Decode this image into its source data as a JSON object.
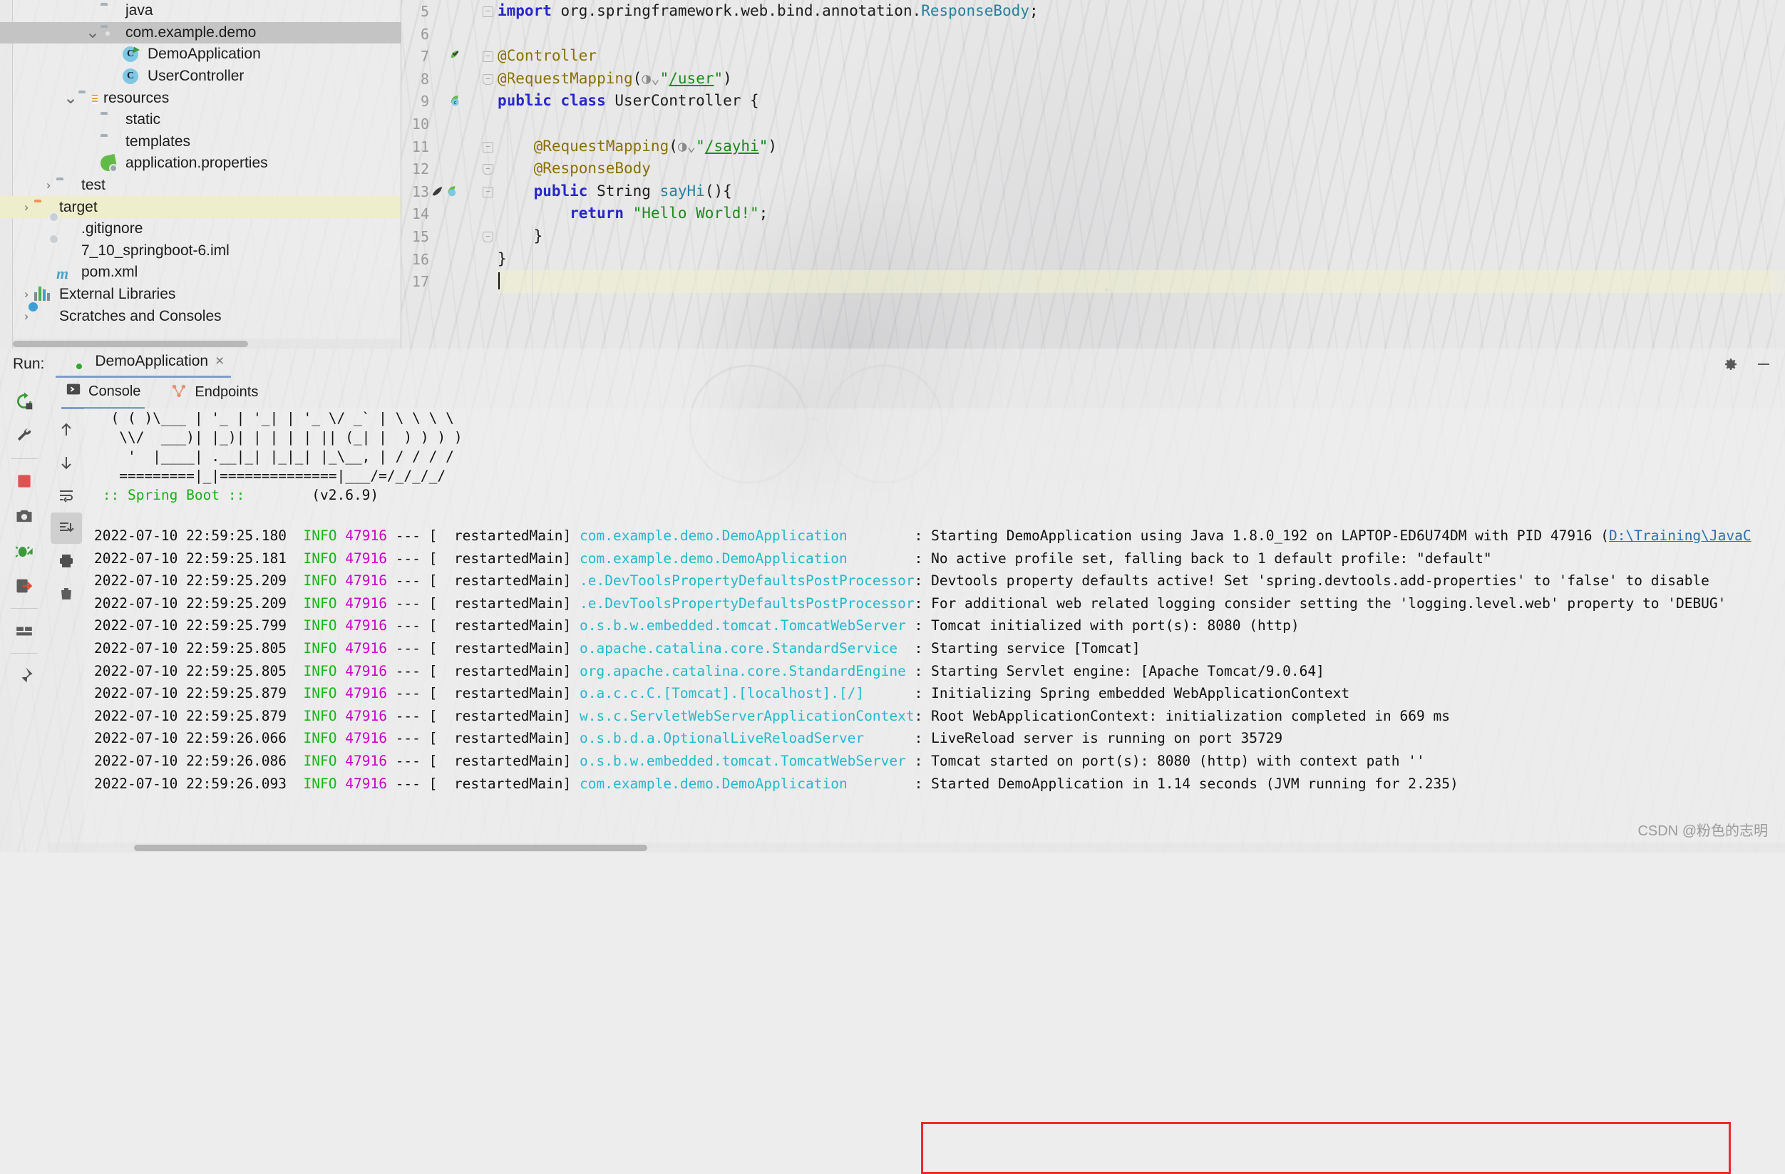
{
  "project": {
    "items": [
      {
        "indent": 3,
        "twisty": "",
        "icon": "folder-icon",
        "label": "java",
        "state": "partial"
      },
      {
        "indent": 3,
        "twisty": "v",
        "icon": "package-folder-icon",
        "label": "com.example.demo",
        "state": "selected"
      },
      {
        "indent": 4,
        "twisty": "",
        "icon": "class-run-icon",
        "label": "DemoApplication",
        "state": "normal"
      },
      {
        "indent": 4,
        "twisty": "",
        "icon": "class-icon",
        "label": "UserController",
        "state": "normal"
      },
      {
        "indent": 2,
        "twisty": "v",
        "icon": "resources-folder-icon",
        "label": "resources",
        "state": "normal"
      },
      {
        "indent": 3,
        "twisty": "",
        "icon": "folder-icon",
        "label": "static",
        "state": "normal"
      },
      {
        "indent": 3,
        "twisty": "",
        "icon": "folder-icon",
        "label": "templates",
        "state": "normal"
      },
      {
        "indent": 3,
        "twisty": "",
        "icon": "spring-leaf-icon",
        "label": "application.properties",
        "state": "normal"
      },
      {
        "indent": 1,
        "twisty": ">",
        "icon": "folder-icon",
        "label": "test",
        "state": "normal"
      },
      {
        "indent": 0,
        "twisty": ">",
        "icon": "folder-orange-icon",
        "label": "target",
        "state": "highlight"
      },
      {
        "indent": 1,
        "twisty": "",
        "icon": "gitignore-file-icon",
        "label": ".gitignore",
        "state": "normal"
      },
      {
        "indent": 1,
        "twisty": "",
        "icon": "iml-file-icon",
        "label": "7_10_springboot-6.iml",
        "state": "normal"
      },
      {
        "indent": 1,
        "twisty": "",
        "icon": "maven-m-icon",
        "label": "pom.xml",
        "state": "normal"
      },
      {
        "indent": 0,
        "twisty": ">",
        "icon": "external-libraries-icon",
        "label": "External Libraries",
        "state": "normal"
      },
      {
        "indent": 0,
        "twisty": ">",
        "icon": "scratches-icon",
        "label": "Scratches and Consoles",
        "state": "normal"
      }
    ]
  },
  "editor": {
    "lines": [
      {
        "num": "5",
        "gutter": "",
        "fold": "minus",
        "text": "import org.springframework.web.bind.annotation.ResponseBody;",
        "tokens": [
          {
            "t": "import ",
            "c": "kw"
          },
          {
            "t": "org.springframework.web.bind.annotation.",
            "c": "plain"
          },
          {
            "t": "ResponseBody",
            "c": "meth"
          },
          {
            "t": ";",
            "c": "plain"
          }
        ],
        "indent": 0,
        "highlight": false
      },
      {
        "num": "6",
        "gutter": "",
        "fold": "",
        "text": "",
        "tokens": [],
        "indent": 0,
        "highlight": false
      },
      {
        "num": "7",
        "gutter": "bean-check-icon",
        "fold": "minus",
        "text": "@Controller",
        "tokens": [
          {
            "t": "@Controller",
            "c": "ann"
          }
        ],
        "indent": 0,
        "highlight": false
      },
      {
        "num": "8",
        "gutter": "",
        "fold": "up",
        "text": "@RequestMapping(\"/user\")",
        "tokens": [
          {
            "t": "@RequestMapping",
            "c": "ann"
          },
          {
            "t": "(",
            "c": "plain"
          },
          {
            "t": "GLOBE",
            "c": "icon"
          },
          {
            "t": "\"",
            "c": "str"
          },
          {
            "t": "/user",
            "c": "urllink"
          },
          {
            "t": "\"",
            "c": "str"
          },
          {
            "t": ")",
            "c": "plain"
          }
        ],
        "indent": 0,
        "highlight": false
      },
      {
        "num": "9",
        "gutter": "bean-icon",
        "fold": "",
        "text": "public class UserController {",
        "tokens": [
          {
            "t": "public class ",
            "c": "kw"
          },
          {
            "t": "UserController {",
            "c": "plain"
          }
        ],
        "indent": 0,
        "highlight": false
      },
      {
        "num": "10",
        "gutter": "",
        "fold": "",
        "text": "",
        "tokens": [],
        "indent": 0,
        "highlight": false
      },
      {
        "num": "11",
        "gutter": "",
        "fold": "minus",
        "text": "    @RequestMapping(\"/sayhi\")",
        "tokens": [
          {
            "t": "    @RequestMapping",
            "c": "ann"
          },
          {
            "t": "(",
            "c": "plain"
          },
          {
            "t": "GLOBE",
            "c": "icon"
          },
          {
            "t": "\"",
            "c": "str"
          },
          {
            "t": "/sayhi",
            "c": "urllink"
          },
          {
            "t": "\"",
            "c": "str"
          },
          {
            "t": ")",
            "c": "plain"
          }
        ],
        "indent": 1,
        "highlight": false
      },
      {
        "num": "12",
        "gutter": "",
        "fold": "up",
        "text": "    @ResponseBody",
        "tokens": [
          {
            "t": "    @ResponseBody",
            "c": "ann"
          }
        ],
        "indent": 1,
        "highlight": false
      },
      {
        "num": "13",
        "gutter": "rocket-bean-icon",
        "fold": "minus",
        "text": "    public String sayHi(){",
        "tokens": [
          {
            "t": "    public ",
            "c": "kw"
          },
          {
            "t": "String ",
            "c": "plain"
          },
          {
            "t": "sayHi",
            "c": "meth"
          },
          {
            "t": "(){",
            "c": "plain"
          }
        ],
        "indent": 1,
        "highlight": false
      },
      {
        "num": "14",
        "gutter": "",
        "fold": "",
        "text": "        return \"Hello World!\";",
        "tokens": [
          {
            "t": "        return ",
            "c": "kw"
          },
          {
            "t": "\"Hello World!\"",
            "c": "str"
          },
          {
            "t": ";",
            "c": "plain"
          }
        ],
        "indent": 2,
        "highlight": false
      },
      {
        "num": "15",
        "gutter": "",
        "fold": "up",
        "text": "    }",
        "tokens": [
          {
            "t": "    }",
            "c": "plain"
          }
        ],
        "indent": 1,
        "highlight": false
      },
      {
        "num": "16",
        "gutter": "",
        "fold": "",
        "text": "}",
        "tokens": [
          {
            "t": "}",
            "c": "plain"
          }
        ],
        "indent": 0,
        "highlight": false
      },
      {
        "num": "17",
        "gutter": "",
        "fold": "",
        "text": "",
        "tokens": [],
        "indent": 0,
        "highlight": true,
        "caret": true
      }
    ]
  },
  "run_panel": {
    "run_label": "Run:",
    "tab_name": "DemoApplication",
    "tab_close": "×",
    "header_icons": [
      "gear-icon",
      "minimize-icon"
    ],
    "side_tools": [
      "rerun-icon",
      "wrench-icon",
      "stop-icon",
      "camera-icon",
      "debug-icon",
      "enter-icon",
      "layout-icon",
      "pin-icon"
    ],
    "console_tabs": [
      {
        "label": "Console",
        "icon": "console-icon",
        "active": true
      },
      {
        "label": "Endpoints",
        "icon": "endpoints-icon",
        "active": false
      }
    ],
    "console_tools": [
      "scroll-up-icon",
      "scroll-down-icon",
      "soft-wrap-icon",
      "scroll-to-end-icon",
      "print-icon",
      "trash-icon"
    ]
  },
  "console": {
    "banner": [
      "  ( ( )\\___ | '_ | '_| | '_ \\/ _` | \\ \\ \\ \\",
      "   \\\\/  ___)| |_)| | | | | || (_| |  ) ) ) )",
      "    '  |____| .__|_| |_|_| |_\\__, | / / / /",
      "   =========|_|==============|___/=/_/_/_/"
    ],
    "spring_boot_label": " :: Spring Boot :: ",
    "spring_boot_version": "       (v2.6.9)",
    "columns": {
      "level": "INFO",
      "pid": "47916",
      "dash": "---",
      "thread": "restartedMain"
    },
    "rows": [
      {
        "time": "2022-07-10 22:59:25.180",
        "logger": "com.example.demo.DemoApplication",
        "msg": ": Starting DemoApplication using Java 1.8.0_192 on LAPTOP-ED6U74DM with PID 47916 (",
        "link": "D:\\Training\\JavaC"
      },
      {
        "time": "2022-07-10 22:59:25.181",
        "logger": "com.example.demo.DemoApplication",
        "msg": ": No active profile set, falling back to 1 default profile: \"default\"",
        "link": ""
      },
      {
        "time": "2022-07-10 22:59:25.209",
        "logger": ".e.DevToolsPropertyDefaultsPostProcessor",
        "msg": ": Devtools property defaults active! Set 'spring.devtools.add-properties' to 'false' to disable",
        "link": ""
      },
      {
        "time": "2022-07-10 22:59:25.209",
        "logger": ".e.DevToolsPropertyDefaultsPostProcessor",
        "msg": ": For additional web related logging consider setting the 'logging.level.web' property to 'DEBUG'",
        "link": ""
      },
      {
        "time": "2022-07-10 22:59:25.799",
        "logger": "o.s.b.w.embedded.tomcat.TomcatWebServer",
        "msg": ": Tomcat initialized with port(s): 8080 (http)",
        "link": ""
      },
      {
        "time": "2022-07-10 22:59:25.805",
        "logger": "o.apache.catalina.core.StandardService",
        "msg": ": Starting service [Tomcat]",
        "link": ""
      },
      {
        "time": "2022-07-10 22:59:25.805",
        "logger": "org.apache.catalina.core.StandardEngine",
        "msg": ": Starting Servlet engine: [Apache Tomcat/9.0.64]",
        "link": ""
      },
      {
        "time": "2022-07-10 22:59:25.879",
        "logger": "o.a.c.c.C.[Tomcat].[localhost].[/]",
        "msg": ": Initializing Spring embedded WebApplicationContext",
        "link": ""
      },
      {
        "time": "2022-07-10 22:59:25.879",
        "logger": "w.s.c.ServletWebServerApplicationContext",
        "msg": ": Root WebApplicationContext: initialization completed in 669 ms",
        "link": ""
      },
      {
        "time": "2022-07-10 22:59:26.066",
        "logger": "o.s.b.d.a.OptionalLiveReloadServer",
        "msg": ": LiveReload server is running on port 35729",
        "link": ""
      },
      {
        "time": "2022-07-10 22:59:26.086",
        "logger": "o.s.b.w.embedded.tomcat.TomcatWebServer",
        "msg": ": Tomcat started on port(s): 8080 (http) with context path ''",
        "link": ""
      },
      {
        "time": "2022-07-10 22:59:26.093",
        "logger": "com.example.demo.DemoApplication",
        "msg": ": Started DemoApplication in 1.14 seconds (JVM running for 2.235)",
        "link": ""
      }
    ]
  },
  "watermark": "CSDN @粉色的志明",
  "colors": {
    "accent": "#7f9ec7",
    "highlight_box": "#ee2b2b",
    "logger": "#23b9cf",
    "info": "#19b519",
    "pid": "#cc00cc",
    "keyword": "#2727c9",
    "annotation": "#8a7000",
    "string": "#1a8c1a",
    "selection": "#c4c4c4",
    "row_highlight": "#eeeecc"
  }
}
